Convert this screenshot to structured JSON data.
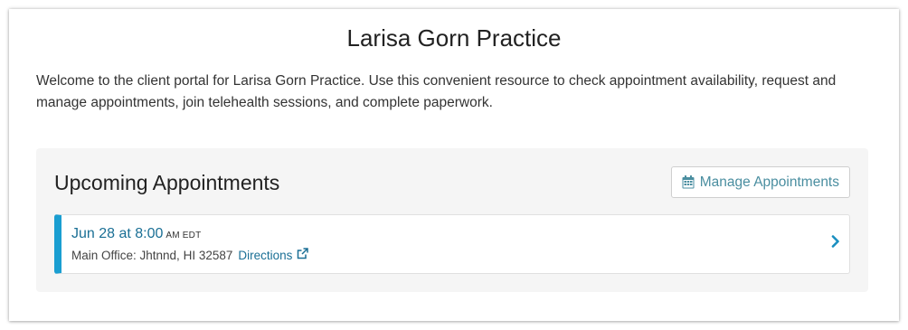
{
  "page": {
    "title": "Larisa Gorn Practice",
    "welcome": "Welcome to the client portal for Larisa Gorn Practice. Use this convenient resource to check appointment availability, request and manage appointments, join telehealth sessions, and complete paperwork."
  },
  "appointments": {
    "heading": "Upcoming Appointments",
    "manage_label": "Manage Appointments",
    "manage_icon": "calendar-icon",
    "items": [
      {
        "date": "Jun 28 at 8:00",
        "tz": "AM EDT",
        "location": "Main Office: Jhtnnd, HI 32587",
        "directions_label": "Directions",
        "directions_icon": "external-link-icon"
      }
    ]
  },
  "colors": {
    "accent": "#1a9ed1",
    "link": "#1a6f95",
    "button_text": "#4a8ea0",
    "panel_bg": "#f5f5f5"
  }
}
